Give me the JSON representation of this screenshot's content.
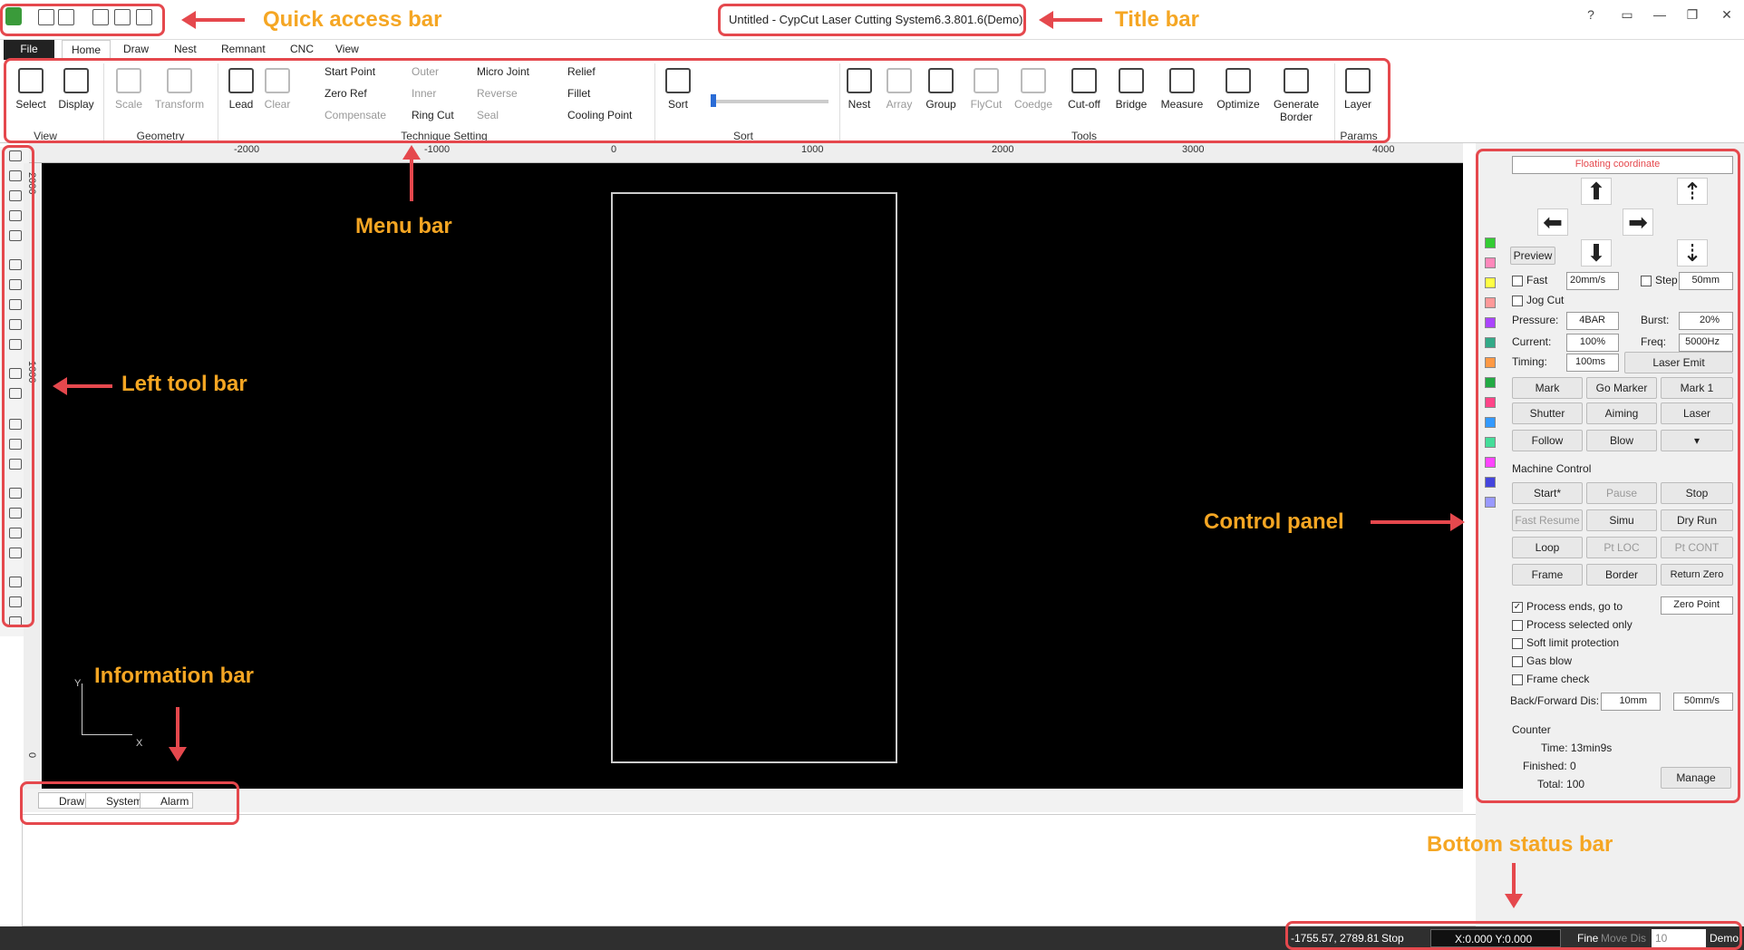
{
  "title_bar": {
    "title": "Untitled - CypCut Laser Cutting System6.3.801.6(Demo)",
    "help": "?",
    "minimize": "—",
    "restore": "❐",
    "close": "✕"
  },
  "menu": {
    "file": "File",
    "tabs": [
      "Home",
      "Draw",
      "Nest",
      "Remnant",
      "CNC",
      "View"
    ]
  },
  "ribbon": {
    "select": "Select",
    "display": "Display",
    "scale": "Scale",
    "transform": "Transform",
    "lead": "Lead",
    "clear": "Clear",
    "start_point": "Start Point",
    "zero_ref": "Zero Ref",
    "compensate": "Compensate",
    "outer": "Outer",
    "inner": "Inner",
    "ring_cut": "Ring Cut",
    "micro_joint": "Micro Joint",
    "reverse": "Reverse",
    "seal": "Seal",
    "relief": "Relief",
    "fillet": "Fillet",
    "cooling_point": "Cooling Point",
    "sort": "Sort",
    "nest": "Nest",
    "array": "Array",
    "group": "Group",
    "flycut": "FlyCut",
    "coedge": "Coedge",
    "cutoff": "Cut-off",
    "bridge": "Bridge",
    "measure": "Measure",
    "optimize": "Optimize",
    "generate_border_1": "Generate",
    "generate_border_2": "Border",
    "layer": "Layer",
    "groups": {
      "view": "View",
      "geometry": "Geometry",
      "technique": "Technique Setting",
      "sort": "Sort",
      "tools": "Tools",
      "params": "Params"
    }
  },
  "ruler": {
    "top": [
      "-2000",
      "-1000",
      "0",
      "1000",
      "2000",
      "3000",
      "4000"
    ],
    "left": [
      "2000",
      "1000",
      "0"
    ]
  },
  "canvas": {
    "axis_y": "Y",
    "axis_x": "X"
  },
  "info_tabs": [
    "Draw",
    "System",
    "Alarm"
  ],
  "status": {
    "coords": "-1755.57, 2789.81",
    "state": "Stop",
    "xy": "X:0.000 Y:0.000",
    "fine": "Fine",
    "move_dis": "Move Dis",
    "move_val": "10",
    "mode": "Demo"
  },
  "control_panel": {
    "coordinate": "Floating coordinate",
    "preview": "Preview",
    "fast": "Fast",
    "fast_speed": "20mm/s",
    "step": "Step",
    "step_val": "50mm",
    "jog_cut": "Jog Cut",
    "pressure_label": "Pressure:",
    "pressure": "4BAR",
    "burst_label": "Burst:",
    "burst": "20%",
    "current_label": "Current:",
    "current": "100%",
    "freq_label": "Freq:",
    "freq": "5000Hz",
    "timing_label": "Timing:",
    "timing": "100ms",
    "laser_emit": "Laser Emit",
    "mark": "Mark",
    "go_marker": "Go Marker",
    "mark1": "Mark 1",
    "shutter": "Shutter",
    "aiming": "Aiming",
    "laser": "Laser",
    "follow": "Follow",
    "blow": "Blow",
    "machine_control": "Machine Control",
    "start": "Start*",
    "pause": "Pause",
    "stop": "Stop",
    "fast_resume": "Fast Resume",
    "simu": "Simu",
    "dry_run": "Dry Run",
    "loop": "Loop",
    "pt_loc": "Pt LOC",
    "pt_cont": "Pt CONT",
    "frame": "Frame",
    "border": "Border",
    "return_zero": "Return Zero",
    "process_ends": "Process ends, go to",
    "zero_point": "Zero Point",
    "process_selected": "Process selected only",
    "soft_limit": "Soft limit protection",
    "gas_blow": "Gas blow",
    "frame_check": "Frame check",
    "back_forward": "Back/Forward Dis:",
    "bf_dist": "10mm",
    "bf_speed": "50mm/s",
    "counter": "Counter",
    "time": "Time: 13min9s",
    "finished": "Finished: 0",
    "total": "Total: 100",
    "manage": "Manage"
  },
  "annotations": {
    "quick_access": "Quick access bar",
    "title_bar": "Title bar",
    "menu_bar": "Menu bar",
    "left_tool_bar": "Left tool bar",
    "information_bar": "Information bar",
    "control_panel": "Control panel",
    "bottom_status_bar": "Bottom status bar"
  },
  "colors": {
    "annotation_text": "#f5a623",
    "annotation_box": "#e5484d",
    "canvas": "#000000"
  }
}
